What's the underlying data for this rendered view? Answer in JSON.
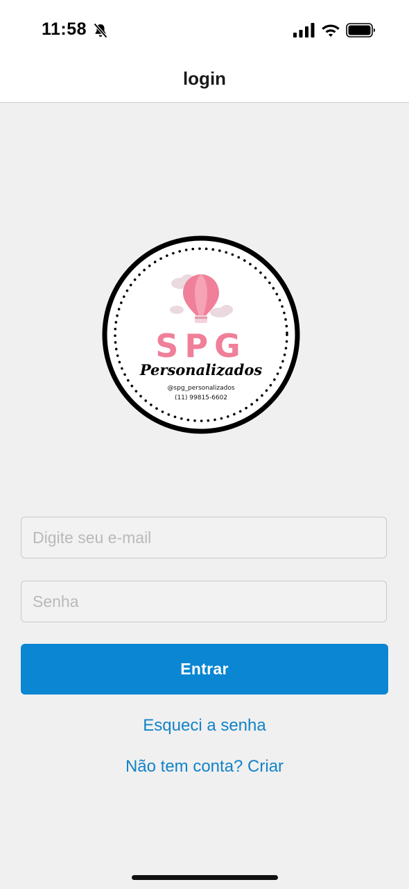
{
  "status_bar": {
    "time": "11:58",
    "icons": [
      "bell-slash-icon",
      "signal-icon",
      "wifi-icon",
      "battery-icon"
    ]
  },
  "header": {
    "title": "login"
  },
  "logo": {
    "brand": "SPG",
    "name": "Personalizados",
    "handle": "@spg_personalizados",
    "phone": "(11) 99815-6602",
    "colors": {
      "brand_pink": "#f07f9a",
      "ring": "#000000"
    }
  },
  "form": {
    "email_placeholder": "Digite seu e-mail",
    "email_value": "",
    "password_placeholder": "Senha",
    "password_value": "",
    "submit_label": "Entrar"
  },
  "links": {
    "forgot_password": "Esqueci a senha",
    "signup": "Não tem conta? Criar"
  },
  "colors": {
    "accent": "#0a86d3",
    "link": "#1183c8",
    "background": "#f0f0f0"
  }
}
